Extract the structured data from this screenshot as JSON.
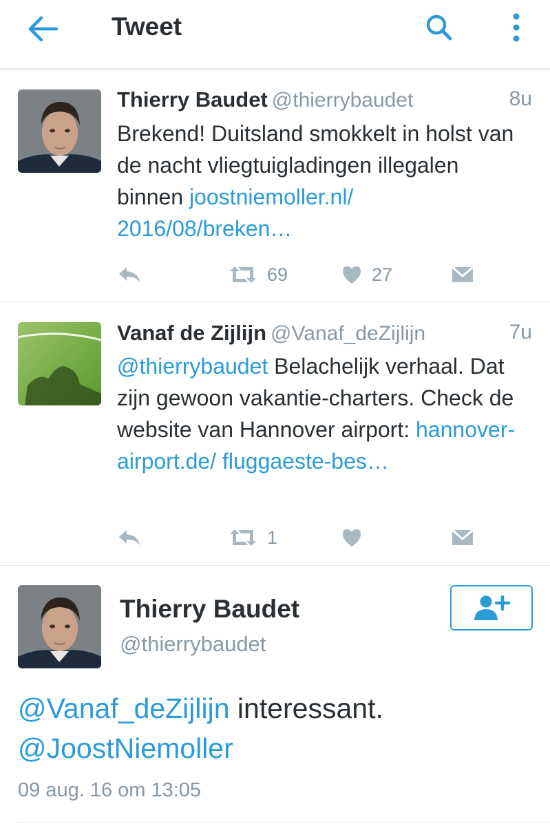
{
  "appbar": {
    "title": "Tweet",
    "back_icon": "arrow-left-icon",
    "search_icon": "search-icon",
    "more_icon": "more-vertical-icon",
    "accent": "#2b9bd8"
  },
  "replies": [
    {
      "name": "Thierry Baudet",
      "handle": "@thierrybaudet",
      "time": "8u",
      "text": "Brekend! Duitsland smokkelt in holst van de nacht vliegtuigladingen illegalen binnen ",
      "link": "joostniemoller.nl/ 2016/08/breken…",
      "retweets": "69",
      "likes": "27"
    },
    {
      "name": "Vanaf de Zijlijn",
      "handle": "@Vanaf_deZijlijn",
      "time": "7u",
      "mention": "@thierrybaudet",
      "text": " Belachelijk verhaal. Dat zijn gewoon vakantie-charters. Check de website van Hannover airport:  ",
      "link": "hannover-airport.de/ fluggaeste-bes…",
      "retweets": "1",
      "likes": ""
    }
  ],
  "detail": {
    "name": "Thierry Baudet",
    "handle": "@thierrybaudet",
    "follow_icon": "follow-user-plus-icon",
    "mention_1": "@Vanaf_deZijlijn",
    "text": " interessant.",
    "mention_2": "@JoostNiemoller",
    "timestamp": "09 aug. 16 om 13:05"
  },
  "colors": {
    "link": "#2b9bd8",
    "muted": "#8899a6",
    "action_icon": "#aab8c2",
    "text": "#292f33"
  }
}
